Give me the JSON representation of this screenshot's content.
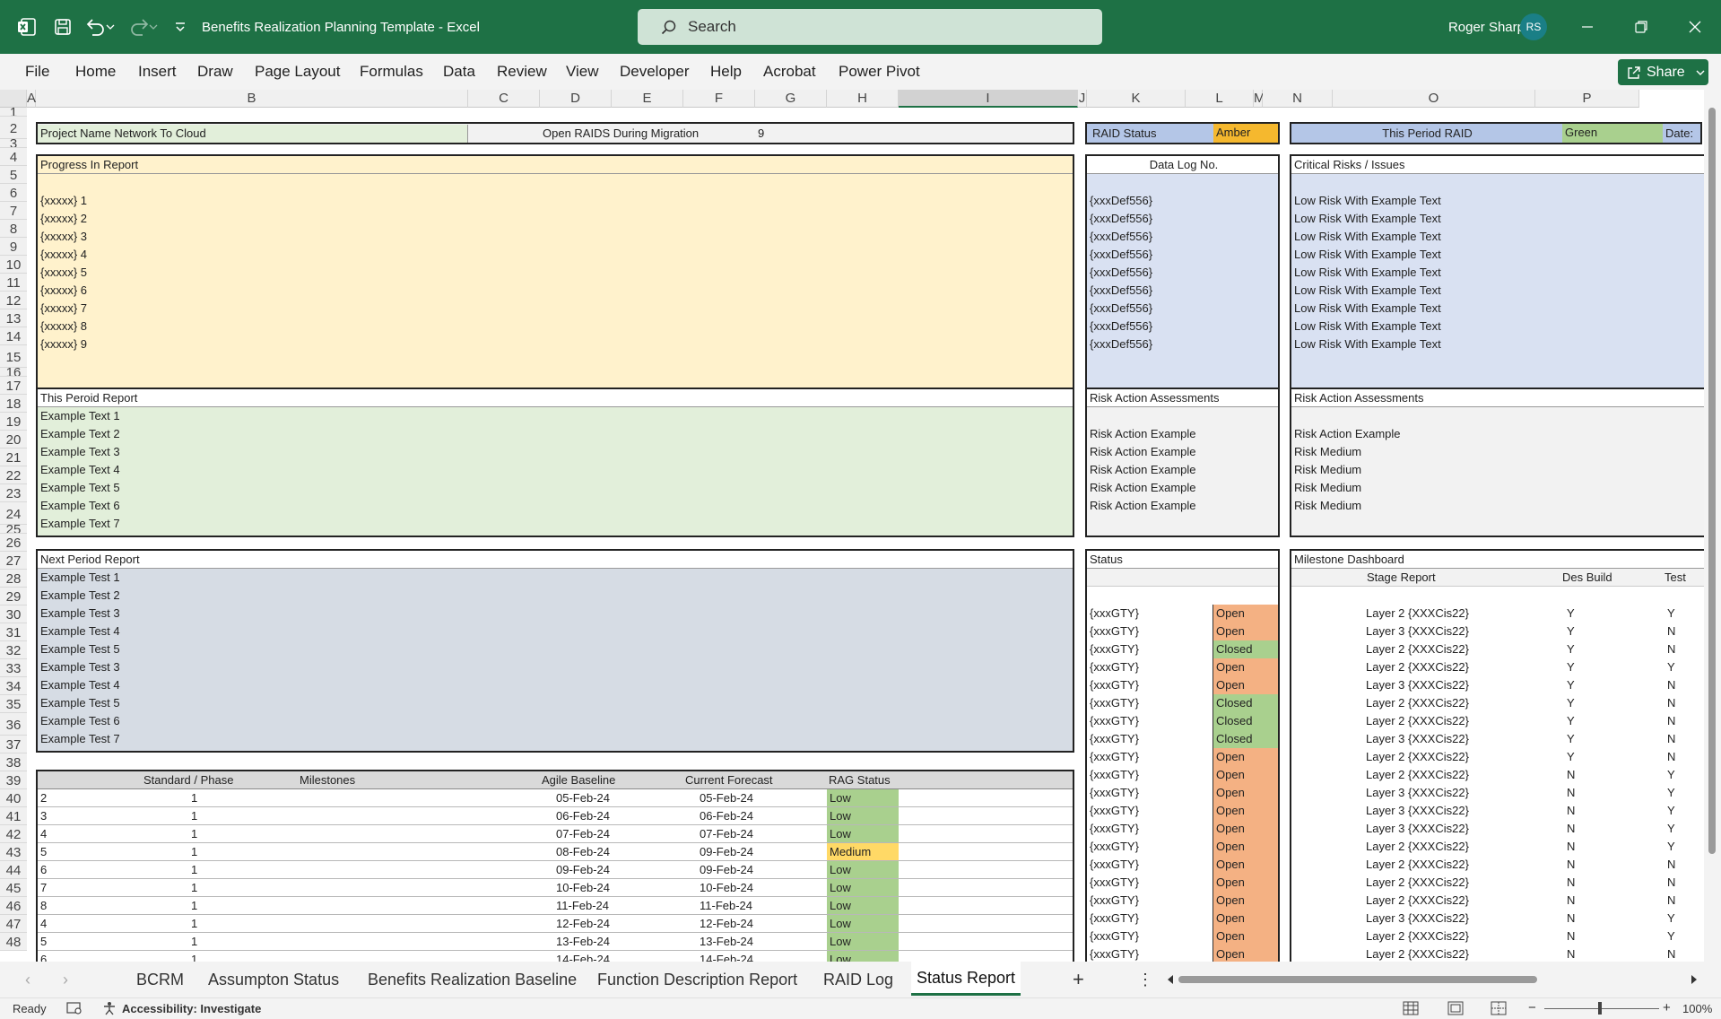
{
  "app": {
    "title": "Benefits Realization Planning Template  -  Excel",
    "search_placeholder": "Search",
    "user_name": "Roger Sharp",
    "user_initials": "RS"
  },
  "ribbon": {
    "tabs": [
      "File",
      "Home",
      "Insert",
      "Draw",
      "Page Layout",
      "Formulas",
      "Data",
      "Review",
      "View",
      "Developer",
      "Help",
      "Acrobat",
      "Power Pivot"
    ],
    "share_label": "Share"
  },
  "columns": [
    "A",
    "B",
    "C",
    "D",
    "E",
    "F",
    "G",
    "H",
    "I",
    "J",
    "K",
    "L",
    "M",
    "N",
    "O",
    "P"
  ],
  "rows": [
    "1",
    "2",
    "3",
    "4",
    "5",
    "6",
    "7",
    "8",
    "9",
    "10",
    "11",
    "12",
    "13",
    "14",
    "15",
    "16",
    "17",
    "18",
    "19",
    "20",
    "21",
    "22",
    "23",
    "24",
    "25",
    "26",
    "27",
    "28",
    "29",
    "30",
    "31",
    "32",
    "33",
    "34",
    "35",
    "36",
    "37",
    "38",
    "39",
    "40",
    "41",
    "42",
    "43",
    "44",
    "45",
    "46",
    "47",
    "48"
  ],
  "header": {
    "project_name": "Project Name Network To Cloud",
    "open_raids_label": "Open RAIDS During Migration",
    "open_raids_value": "9",
    "raid_status_label": "RAID Status",
    "raid_status_value": "Amber",
    "this_period_raid_label": "This Period RAID",
    "this_period_raid_value": "Green",
    "date_label": "Date:"
  },
  "progress": {
    "title": "Progress In Report",
    "items": [
      "{xxxxx} 1",
      "{xxxxx} 2",
      "{xxxxx} 3",
      "{xxxxx} 4",
      "{xxxxx} 5",
      "{xxxxx} 6",
      "{xxxxx} 7",
      "{xxxxx} 8",
      "{xxxxx} 9"
    ]
  },
  "data_log": {
    "title": "Data Log No.",
    "items": [
      "{xxxDef556}",
      "{xxxDef556}",
      "{xxxDef556}",
      "{xxxDef556}",
      "{xxxDef556}",
      "{xxxDef556}",
      "{xxxDef556}",
      "{xxxDef556}",
      "{xxxDef556}"
    ]
  },
  "critical_risks": {
    "title": "Critical Risks / Issues",
    "items": [
      "Low Risk With Example Text",
      "Low Risk With Example Text",
      "Low Risk With Example Text",
      "Low Risk With Example Text",
      "Low Risk With Example Text",
      "Low Risk With Example Text",
      "Low Risk With Example Text",
      "Low Risk With Example Text",
      "Low Risk With Example Text"
    ]
  },
  "this_period": {
    "title": "This Peroid Report",
    "items": [
      "Example Text 1",
      "Example Text 2",
      "Example Text 3",
      "Example Text 4",
      "Example Text 5",
      "Example Text 6",
      "Example Text 7"
    ]
  },
  "risk_action_1": {
    "title": "Risk Action Assessments",
    "items": [
      "Risk Action Example",
      "Risk Action Example",
      "Risk Action Example",
      "Risk Action Example",
      "Risk Action Example"
    ]
  },
  "risk_action_2": {
    "title": "Risk Action Assessments",
    "items": [
      "Risk Action Example",
      "Risk Medium",
      "Risk Medium",
      "Risk Medium",
      "Risk Medium"
    ]
  },
  "next_period": {
    "title": "Next Period Report",
    "items": [
      "Example Test 1",
      "Example Test 2",
      "Example Test 3",
      "Example Test 4",
      "Example Test 5",
      "Example Test 3",
      "Example Test 4",
      "Example Test 5",
      "Example Test 6",
      "Example Test 7"
    ]
  },
  "status_panel": {
    "title": "Status",
    "rows": [
      {
        "code": "{xxxGTY}",
        "status": "Open"
      },
      {
        "code": "{xxxGTY}",
        "status": "Open"
      },
      {
        "code": "{xxxGTY}",
        "status": "Closed"
      },
      {
        "code": "{xxxGTY}",
        "status": "Open"
      },
      {
        "code": "{xxxGTY}",
        "status": "Open"
      },
      {
        "code": "{xxxGTY}",
        "status": "Closed"
      },
      {
        "code": "{xxxGTY}",
        "status": "Closed"
      },
      {
        "code": "{xxxGTY}",
        "status": "Closed"
      },
      {
        "code": "{xxxGTY}",
        "status": "Open"
      },
      {
        "code": "{xxxGTY}",
        "status": "Open"
      },
      {
        "code": "{xxxGTY}",
        "status": "Open"
      },
      {
        "code": "{xxxGTY}",
        "status": "Open"
      },
      {
        "code": "{xxxGTY}",
        "status": "Open"
      },
      {
        "code": "{xxxGTY}",
        "status": "Open"
      },
      {
        "code": "{xxxGTY}",
        "status": "Open"
      },
      {
        "code": "{xxxGTY}",
        "status": "Open"
      },
      {
        "code": "{xxxGTY}",
        "status": "Open"
      },
      {
        "code": "{xxxGTY}",
        "status": "Open"
      },
      {
        "code": "{xxxGTY}",
        "status": "Open"
      },
      {
        "code": "{xxxGTY}",
        "status": "Open"
      }
    ]
  },
  "milestone_dashboard": {
    "title": "Milestone Dashboard",
    "headers": {
      "stage": "Stage Report",
      "des_build": "Des Build",
      "test": "Test"
    },
    "rows": [
      {
        "stage": "Layer 2 {XXXCis22}",
        "des": "Y",
        "test": "Y"
      },
      {
        "stage": "Layer 3 {XXXCis22}",
        "des": "Y",
        "test": "N"
      },
      {
        "stage": "Layer 2 {XXXCis22}",
        "des": "Y",
        "test": "N"
      },
      {
        "stage": "Layer 2 {XXXCis22}",
        "des": "Y",
        "test": "Y"
      },
      {
        "stage": "Layer 3 {XXXCis22}",
        "des": "Y",
        "test": "N"
      },
      {
        "stage": "Layer 2 {XXXCis22}",
        "des": "Y",
        "test": "N"
      },
      {
        "stage": "Layer 2 {XXXCis22}",
        "des": "Y",
        "test": "N"
      },
      {
        "stage": "Layer 3 {XXXCis22}",
        "des": "Y",
        "test": "N"
      },
      {
        "stage": "Layer 2 {XXXCis22}",
        "des": "Y",
        "test": "N"
      },
      {
        "stage": "Layer 2 {XXXCis22}",
        "des": "N",
        "test": "Y"
      },
      {
        "stage": "Layer 3 {XXXCis22}",
        "des": "N",
        "test": "Y"
      },
      {
        "stage": "Layer 3 {XXXCis22}",
        "des": "N",
        "test": "Y"
      },
      {
        "stage": "Layer 3 {XXXCis22}",
        "des": "N",
        "test": "Y"
      },
      {
        "stage": "Layer 2 {XXXCis22}",
        "des": "N",
        "test": "Y"
      },
      {
        "stage": "Layer 2 {XXXCis22}",
        "des": "N",
        "test": "N"
      },
      {
        "stage": "Layer 2 {XXXCis22}",
        "des": "N",
        "test": "N"
      },
      {
        "stage": "Layer 2 {XXXCis22}",
        "des": "N",
        "test": "N"
      },
      {
        "stage": "Layer 3 {XXXCis22}",
        "des": "N",
        "test": "Y"
      },
      {
        "stage": "Layer 2 {XXXCis22}",
        "des": "N",
        "test": "Y"
      },
      {
        "stage": "Layer 2 {XXXCis22}",
        "des": "N",
        "test": "N"
      }
    ]
  },
  "milestones_table": {
    "headers": {
      "std": "Standard / Phase",
      "milestones": "Milestones",
      "baseline": "Agile Baseline",
      "forecast": "Current Forecast",
      "rag": "RAG Status"
    },
    "rows": [
      {
        "id": "2",
        "phase": "1",
        "baseline": "05-Feb-24",
        "forecast": "05-Feb-24",
        "rag": "Low"
      },
      {
        "id": "3",
        "phase": "1",
        "baseline": "06-Feb-24",
        "forecast": "06-Feb-24",
        "rag": "Low"
      },
      {
        "id": "4",
        "phase": "1",
        "baseline": "07-Feb-24",
        "forecast": "07-Feb-24",
        "rag": "Low"
      },
      {
        "id": "5",
        "phase": "1",
        "baseline": "08-Feb-24",
        "forecast": "09-Feb-24",
        "rag": "Medium"
      },
      {
        "id": "6",
        "phase": "1",
        "baseline": "09-Feb-24",
        "forecast": "09-Feb-24",
        "rag": "Low"
      },
      {
        "id": "7",
        "phase": "1",
        "baseline": "10-Feb-24",
        "forecast": "10-Feb-24",
        "rag": "Low"
      },
      {
        "id": "8",
        "phase": "1",
        "baseline": "11-Feb-24",
        "forecast": "11-Feb-24",
        "rag": "Low"
      },
      {
        "id": "4",
        "phase": "1",
        "baseline": "12-Feb-24",
        "forecast": "12-Feb-24",
        "rag": "Low"
      },
      {
        "id": "5",
        "phase": "1",
        "baseline": "13-Feb-24",
        "forecast": "13-Feb-24",
        "rag": "Low"
      },
      {
        "id": "6",
        "phase": "1",
        "baseline": "14-Feb-24",
        "forecast": "14-Feb-24",
        "rag": "Low"
      }
    ]
  },
  "sheet_tabs": [
    "BCRM",
    "Assumpton Status",
    "Benefits Realization Baseline",
    "Function Description Report",
    "RAID Log",
    "Status Report"
  ],
  "status_bar": {
    "ready": "Ready",
    "accessibility": "Accessibility: Investigate",
    "zoom": "100%"
  },
  "colors": {
    "excel_green": "#1e7145",
    "amber": "#f5b82e",
    "green_cell": "#a9d08e",
    "open": "#f4b183",
    "closed": "#a9d08e",
    "medium": "#ffd966",
    "progress_bg": "#fff2cc",
    "blue_bg": "#d9e1f2",
    "green_bg": "#e2efda",
    "next_bg": "#d6dce4"
  },
  "icons": [
    "excel-logo-icon",
    "save-icon",
    "undo-icon",
    "redo-icon",
    "customize-qat-icon",
    "search-icon",
    "minimize-icon",
    "restore-icon",
    "close-icon",
    "share-icon",
    "add-sheet-icon",
    "normal-view-icon",
    "page-layout-view-icon",
    "page-break-view-icon"
  ]
}
